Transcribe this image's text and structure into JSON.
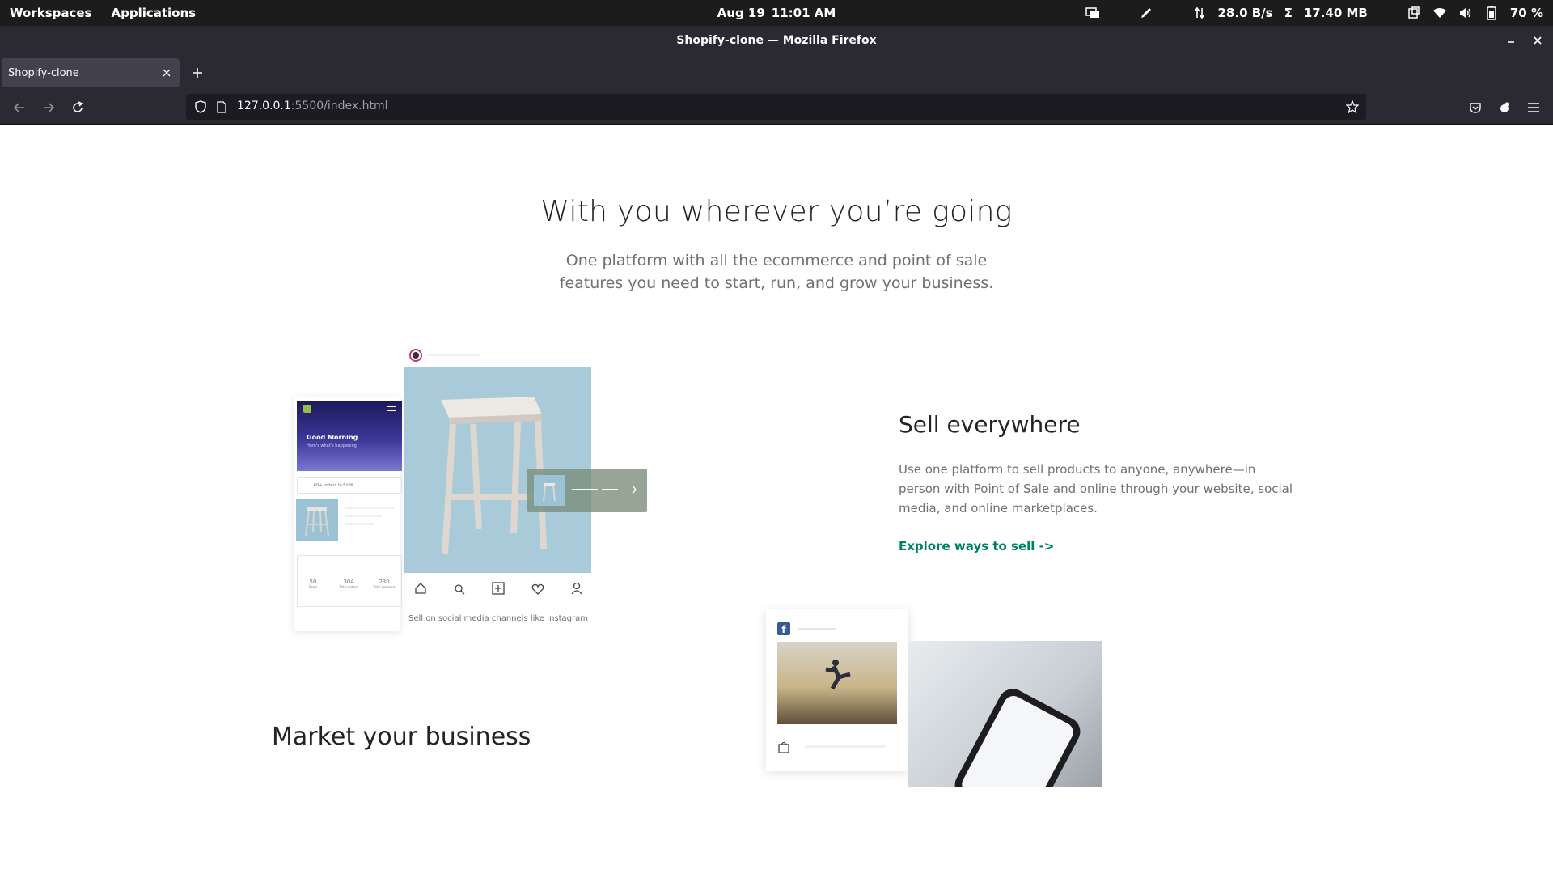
{
  "desktop": {
    "workspaces": "Workspaces",
    "applications": "Applications",
    "date": "Aug 19",
    "time": "11:01 AM",
    "net_speed": "28.0 B/s",
    "net_total": "17.40 MB",
    "battery": "70 %",
    "icons": [
      "screen-share-icon",
      "pen-icon",
      "network-arrows-icon",
      "sum-icon",
      "clipboard-icon",
      "wifi-icon",
      "volume-icon",
      "battery-icon"
    ]
  },
  "browser": {
    "window_title": "Shopify-clone — Mozilla Firefox",
    "tab_label": "Shopify-clone",
    "url_host": "127.0.0.1",
    "url_rest": ":5500/index.html"
  },
  "hero": {
    "title": "With you wherever you’re going",
    "subtitle": "One platform with all the ecommerce and point of sale features you need to start, run, and grow your business."
  },
  "sell": {
    "title": "Sell everywhere",
    "body": "Use one platform to sell products to anyone, anywhere—in person with Point of Sale and online through your website, social media, and online marketplaces.",
    "link": "Explore ways to sell ->",
    "illustration": {
      "greeting": "Good Morning",
      "greeting_sub": "Here's what's happening",
      "orders": "60+ orders to fulfill",
      "stats": [
        {
          "value": "50",
          "label": "Sales"
        },
        {
          "value": "304",
          "label": "Total orders"
        },
        {
          "value": "230",
          "label": "Total sessions"
        }
      ],
      "caption": "Sell on social media channels like Instagram"
    }
  },
  "market": {
    "title": "Market your business"
  },
  "colors": {
    "accent_green": "#008060",
    "chrome_dark": "#2b2a33",
    "topbar": "#1c1c1c"
  }
}
